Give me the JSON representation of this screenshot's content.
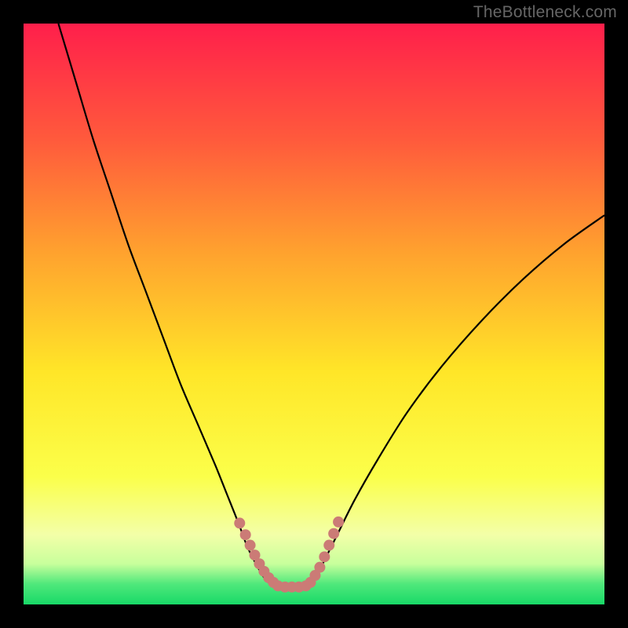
{
  "watermark": {
    "text": "TheBottleneck.com"
  },
  "chart_data": {
    "type": "line",
    "title": "",
    "xlabel": "",
    "ylabel": "",
    "xlim": [
      0,
      100
    ],
    "ylim": [
      0,
      100
    ],
    "gradient_stops": [
      {
        "offset": 0.0,
        "color": "#FF1F4B"
      },
      {
        "offset": 0.2,
        "color": "#FF5A3C"
      },
      {
        "offset": 0.4,
        "color": "#FFA42E"
      },
      {
        "offset": 0.6,
        "color": "#FFE628"
      },
      {
        "offset": 0.78,
        "color": "#FBFF4A"
      },
      {
        "offset": 0.88,
        "color": "#F3FFA8"
      },
      {
        "offset": 0.93,
        "color": "#C8FF9C"
      },
      {
        "offset": 0.965,
        "color": "#4FE87B"
      },
      {
        "offset": 1.0,
        "color": "#18D967"
      }
    ],
    "series": [
      {
        "name": "left-curve",
        "x": [
          6,
          9,
          12,
          15,
          18,
          21,
          24,
          27,
          30,
          33,
          35,
          37,
          38.5,
          40,
          41.5,
          43
        ],
        "y": [
          100,
          90,
          80,
          71,
          62,
          54,
          46,
          38,
          31,
          24,
          19,
          14,
          10,
          7,
          4.5,
          3
        ]
      },
      {
        "name": "right-curve",
        "x": [
          49,
          50.5,
          52,
          54,
          57,
          61,
          66,
          72,
          79,
          86,
          93,
          100
        ],
        "y": [
          3,
          5,
          8,
          12,
          18,
          25,
          33,
          41,
          49,
          56,
          62,
          67
        ]
      },
      {
        "name": "trough-flat",
        "x": [
          43,
          46,
          49
        ],
        "y": [
          3,
          3,
          3
        ]
      }
    ],
    "trough_markers": {
      "left": {
        "x": [
          37.2,
          38.2,
          39.0,
          39.8,
          40.6,
          41.4,
          42.2,
          43.0
        ],
        "y": [
          14.0,
          12.0,
          10.2,
          8.5,
          7.0,
          5.7,
          4.6,
          3.8
        ]
      },
      "floor": {
        "x": [
          43.8,
          45.0,
          46.2,
          47.4,
          48.6
        ],
        "y": [
          3.2,
          3.0,
          3.0,
          3.0,
          3.2
        ]
      },
      "right": {
        "x": [
          49.4,
          50.2,
          51.0,
          51.8,
          52.6,
          53.4,
          54.2
        ],
        "y": [
          3.8,
          5.0,
          6.4,
          8.2,
          10.2,
          12.2,
          14.2
        ]
      }
    },
    "marker_color": "#CB7B76",
    "curve_color": "#000000"
  }
}
